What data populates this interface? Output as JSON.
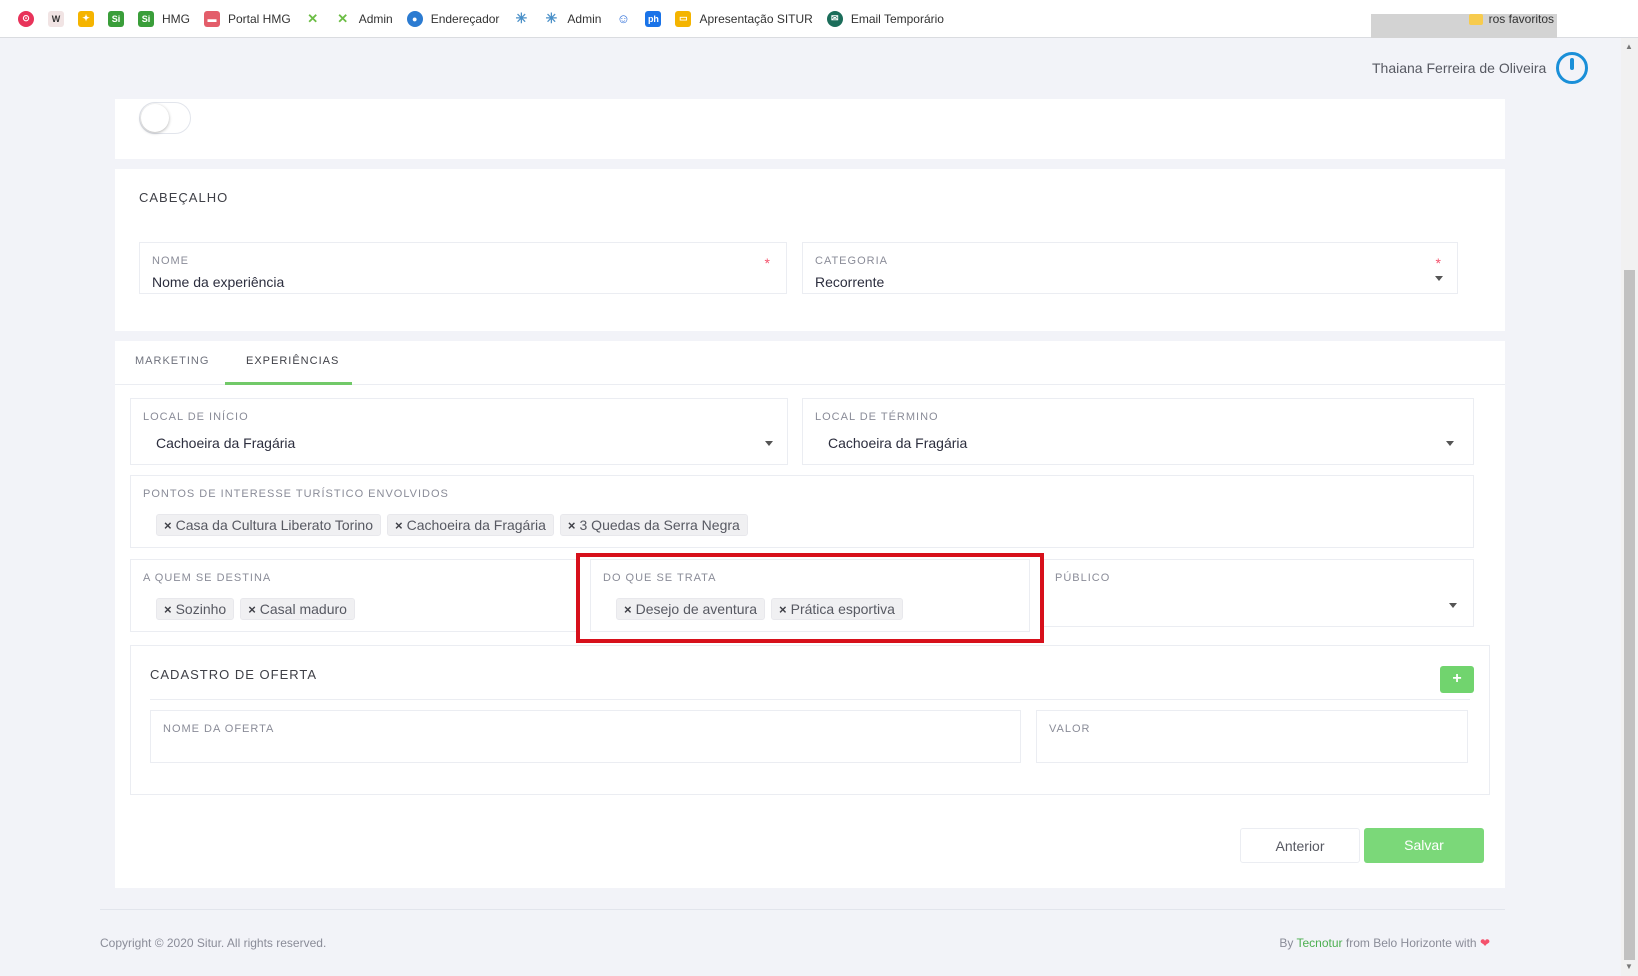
{
  "bookmarks": {
    "items": [
      {
        "label": "",
        "icon": "red-circle-icon",
        "color": "#e8335a"
      },
      {
        "label": "",
        "icon": "w-icon",
        "color": "#f1e4e4"
      },
      {
        "label": "",
        "icon": "bulb-icon",
        "color": "#f5b400"
      },
      {
        "label": "",
        "icon": "si-icon",
        "color": "#3a9e3a"
      },
      {
        "label": "HMG",
        "icon": "si-icon",
        "color": "#3a9e3a"
      },
      {
        "label": "Portal HMG",
        "icon": "portal-icon",
        "color": "#e35d6a"
      },
      {
        "label": "",
        "icon": "x-logo-icon",
        "color": "#6cbd45"
      },
      {
        "label": "Admin",
        "icon": "x-logo-icon",
        "color": "#6cbd45"
      },
      {
        "label": "Endereçador",
        "icon": "endereçador-icon",
        "color": "#2b7bd1"
      },
      {
        "label": "",
        "icon": "asterisk-icon",
        "color": "#4a90c8"
      },
      {
        "label": "Admin",
        "icon": "asterisk-icon",
        "color": "#4a90c8"
      },
      {
        "label": "",
        "icon": "robot-icon",
        "color": "#2f6fd9"
      },
      {
        "label": "",
        "icon": "ph-icon",
        "color": "#1a73e8"
      },
      {
        "label": "Apresentação SITUR",
        "icon": "slides-icon",
        "color": "#f4b400"
      },
      {
        "label": "Email Temporário",
        "icon": "mail-icon",
        "color": "#1b6d5a"
      }
    ],
    "other_favorites": "ros favoritos"
  },
  "user": {
    "name": "Thaiana Ferreira de Oliveira"
  },
  "header_section": {
    "title": "CABEÇALHO",
    "nome_label": "NOME",
    "nome_value": "Nome da experiência",
    "categoria_label": "CATEGORIA",
    "categoria_value": "Recorrente",
    "required_mark": "*"
  },
  "tabs": [
    "MARKETING",
    "EXPERIÊNCIAS"
  ],
  "experiencias": {
    "local_inicio_label": "LOCAL DE INÍCIO",
    "local_inicio_value": "Cachoeira da Fragária",
    "local_termino_label": "LOCAL DE TÉRMINO",
    "local_termino_value": "Cachoeira da Fragária",
    "pontos_label": "PONTOS DE INTERESSE TURÍSTICO ENVOLVIDOS",
    "pontos": [
      "Casa da Cultura Liberato Torino",
      "Cachoeira da Fragária",
      "3 Quedas da Serra Negra"
    ],
    "destina_label": "A QUEM SE DESTINA",
    "destina": [
      "Sozinho",
      "Casal maduro"
    ],
    "trata_label": "DO QUE SE TRATA",
    "trata": [
      "Desejo de aventura",
      "Prática esportiva"
    ],
    "publico_label": "PÚBLICO",
    "chip_remove": "×"
  },
  "oferta": {
    "title": "CADASTRO DE OFERTA",
    "add_label": "+",
    "nome_label": "NOME DA OFERTA",
    "valor_label": "VALOR"
  },
  "buttons": {
    "anterior": "Anterior",
    "salvar": "Salvar"
  },
  "footer": {
    "copyright": "Copyright © 2020 Situr. All rights reserved.",
    "by": "By",
    "brand": "Tecnotur",
    "from": "from Belo Horizonte with",
    "heart": "❤"
  },
  "colors": {
    "accent_green": "#71c968",
    "highlight_red": "#d7101b",
    "required_red": "#f4516c",
    "brand_blue": "#1a8fd8"
  }
}
